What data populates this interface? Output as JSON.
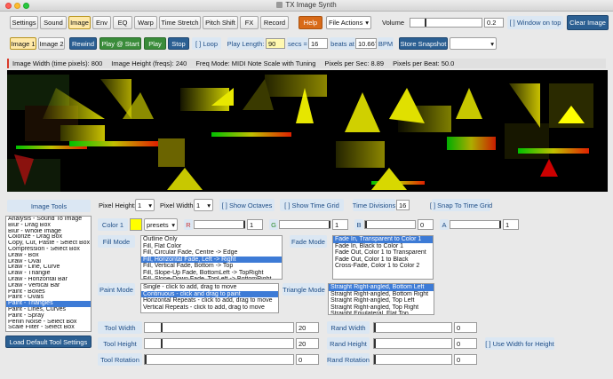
{
  "window": {
    "title": "TX Image Synth"
  },
  "topbar": {
    "tabs": [
      "Settings",
      "Sound",
      "Image",
      "Env",
      "EQ",
      "Warp",
      "Time Stretch",
      "Pitch Shift",
      "FX",
      "Record"
    ],
    "help": "Help",
    "file_actions": "File Actions",
    "volume_label": "Volume",
    "volume_value": "0.2",
    "volume_level": 0.2,
    "window_on_top": "[ ] Window on top",
    "clear_image": "Clear Image"
  },
  "row2": {
    "image1": "Image 1",
    "image2": "Image 2",
    "rewind": "Rewind",
    "play_at_start": "Play @ Start",
    "play": "Play",
    "stop": "Stop",
    "loop": "[ ] Loop",
    "play_length_label": "Play Length:",
    "play_length_value": "90",
    "secs_label": "secs =",
    "beats_value": "16",
    "beats_at": "beats at",
    "bpm_value": "10.667",
    "bpm_label": "BPM",
    "store_snapshot": "Store Snapshot"
  },
  "info": {
    "width": "Image Width (time pixels): 800",
    "height": "Image Height (freqs): 240",
    "freq_mode": "Freq Mode: MIDI Note Scale with Tuning",
    "pps": "Pixels per Sec: 8.89",
    "ppb": "Pixels per Beat: 50.0"
  },
  "canvas_controls": {
    "pixel_height_label": "Pixel Height:",
    "pixel_height_value": "1",
    "pixel_width_label": "Pixel Width:",
    "pixel_width_value": "1",
    "show_octaves": "[ ] Show Octaves",
    "show_time_grid": "[ ] Show Time Grid",
    "time_divisions_label": "Time Divisions",
    "time_divisions_value": "16",
    "snap_to_time_grid": "[ ] Snap To Time Grid"
  },
  "tools": {
    "header": "Image Tools",
    "items": [
      "Analysis - Sound To Image",
      "Blur - Drag Box",
      "Blur - Whole Image",
      "Colorize - Drag Box",
      "Copy, Cut, Paste - Select Box",
      "Compression - Select Box",
      "Draw - Box",
      "Draw - Oval",
      "Draw - Line, Curve",
      "Draw - Triangle",
      "Draw - Horizontal Bar",
      "Draw - Vertical Bar",
      "Paint - Boxes",
      "Paint - Ovals",
      "Paint - Triangles",
      "Paint - Lines, Curves",
      "Paint - Spray",
      "Perlin Noise - Select Box",
      "Scale Filter - Select Box"
    ],
    "selected_index": 14,
    "load_default": "Load Default Tool Settings"
  },
  "color": {
    "label": "Color 1",
    "presets": "presets",
    "swatch": "#ffff00",
    "r_label": "R",
    "r_value": "1",
    "g_label": "G",
    "g_value": "1",
    "b_label": "B",
    "b_value": "0",
    "a_label": "A",
    "a_value": "1"
  },
  "fill": {
    "label": "Fill Mode",
    "items": [
      "Outline Only",
      "Fill, Flat Color",
      "Fill, Circular Fade, Centre -> Edge",
      "Fill, Horizontal Fade, Left -> Right",
      "Fill, Vertical Fade, Bottom -> Top",
      "Fill, Slope-Up Fade, BottomLeft -> TopRight",
      "Fill, Slope-Down Fade, TopLeft -> BottomRight"
    ],
    "selected_index": 3
  },
  "fade": {
    "label": "Fade Mode",
    "items": [
      "Fade In, Transparent to Color 1",
      "Fade In, Black to Color 1",
      "Fade Out, Color 1 to Transparent",
      "Fade Out, Color 1 to Black",
      "Cross-Fade, Color 1 to Color 2"
    ],
    "selected_index": 0
  },
  "paint": {
    "label": "Paint Mode",
    "items": [
      "Single - click to add, drag to move",
      "Continuous - click and drag to paint",
      "Horizontal Repeats - click to add, drag to move",
      "Vertical Repeats - click to add, drag to move"
    ],
    "selected_index": 1
  },
  "triangle": {
    "label": "Triangle Mode",
    "items": [
      "Straight Right-angled, Bottom Left",
      "Straight Right-angled, Bottom Right",
      "Straight Right-angled, Top Left",
      "Straight Right-angled, Top Right",
      "Straight Equilateral, Flat Top"
    ],
    "selected_index": 0
  },
  "sizes": {
    "tool_width_label": "Tool Width",
    "tool_width_value": "20",
    "tool_width_level": 0.05,
    "tool_height_label": "Tool Height",
    "tool_height_value": "20",
    "tool_height_level": 0.05,
    "tool_rotation_label": "Tool Rotation",
    "tool_rotation_value": "0",
    "tool_rotation_level": 0,
    "rand_width_label": "Rand Width",
    "rand_width_value": "0",
    "rand_height_label": "Rand Height",
    "rand_height_value": "0",
    "rand_rotation_label": "Rand Rotation",
    "rand_rotation_value": "0",
    "use_width_for_height": "[ ] Use Width for Height"
  }
}
